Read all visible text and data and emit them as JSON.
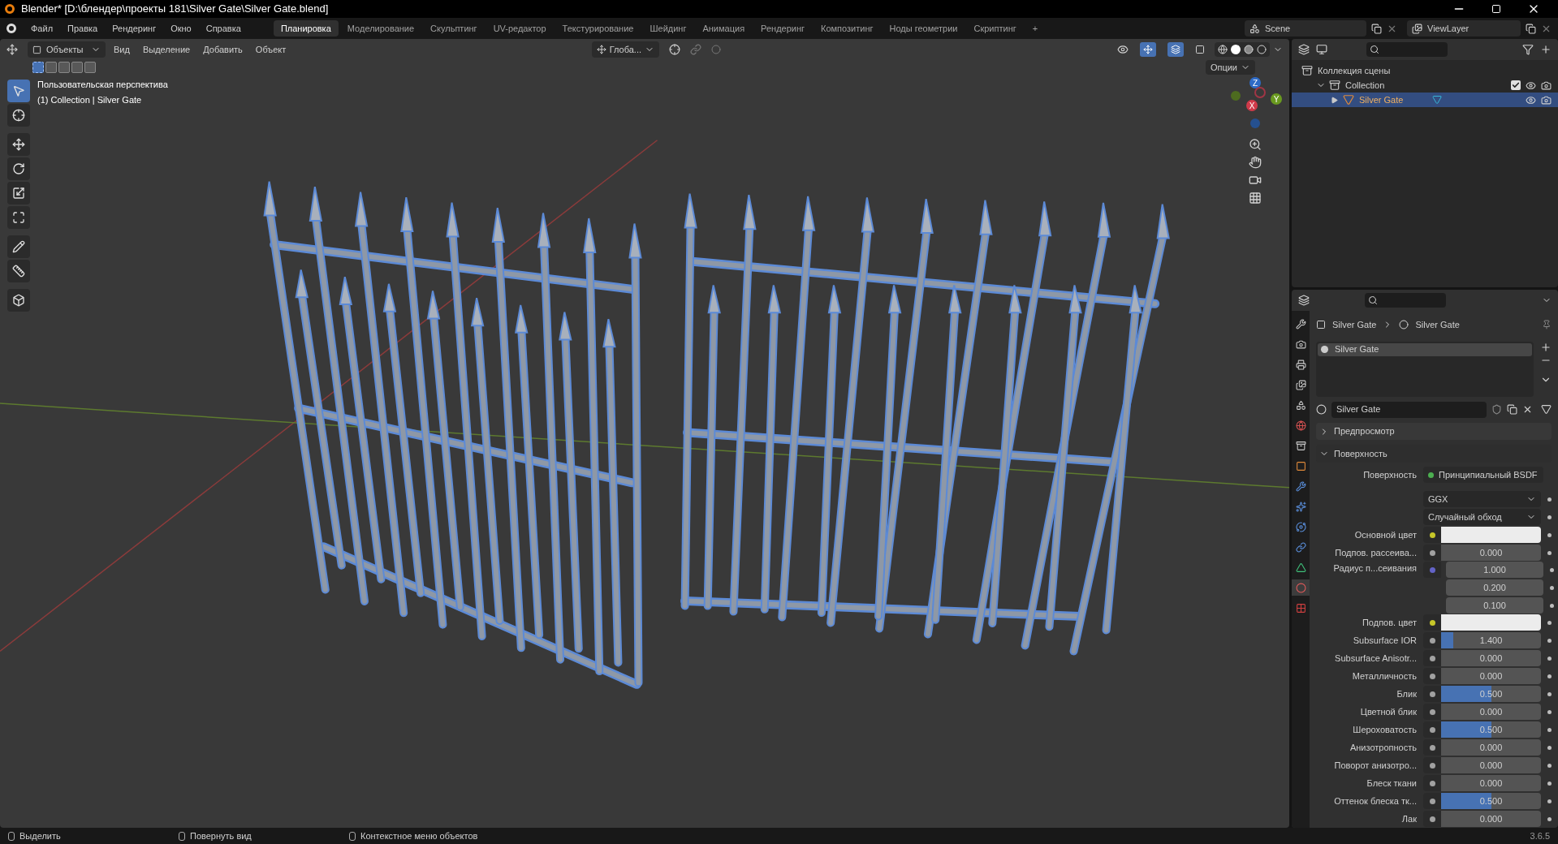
{
  "window": {
    "title": "Blender* [D:\\блендер\\проекты 181\\Silver Gate\\Silver Gate.blend]"
  },
  "menu": [
    "Файл",
    "Правка",
    "Рендеринг",
    "Окно",
    "Справка"
  ],
  "workspaces": [
    {
      "label": "Планировка",
      "selected": true
    },
    {
      "label": "Моделирование",
      "selected": false
    },
    {
      "label": "Скульптинг",
      "selected": false
    },
    {
      "label": "UV-редактор",
      "selected": false
    },
    {
      "label": "Текстурирование",
      "selected": false
    },
    {
      "label": "Шейдинг",
      "selected": false
    },
    {
      "label": "Анимация",
      "selected": false
    },
    {
      "label": "Рендеринг",
      "selected": false
    },
    {
      "label": "Композитинг",
      "selected": false
    },
    {
      "label": "Ноды геометрии",
      "selected": false
    },
    {
      "label": "Скриптинг",
      "selected": false
    },
    {
      "label": "+",
      "selected": false
    }
  ],
  "scene": {
    "name": "Scene",
    "view_layer": "ViewLayer"
  },
  "viewport": {
    "mode": "Объекты",
    "menus": [
      "Вид",
      "Выделение",
      "Добавить",
      "Объект"
    ],
    "orientation": "Глоба...",
    "options": "Опции",
    "perspective": "Пользовательская перспектива",
    "object_info": "(1) Collection | Silver Gate",
    "gizmo_axes": [
      "Z",
      "Y",
      "X"
    ],
    "select_modes": [
      {
        "selected": true
      },
      {
        "selected": false
      },
      {
        "selected": false
      },
      {
        "selected": false
      },
      {
        "selected": false
      }
    ],
    "tools": [
      {
        "kind": "select",
        "selected": true
      },
      {
        "kind": "cursor",
        "selected": false
      },
      {
        "kind": "move",
        "selected": false
      },
      {
        "kind": "rotate",
        "selected": false
      },
      {
        "kind": "scale",
        "selected": false
      },
      {
        "kind": "transform",
        "selected": false
      },
      {
        "kind": "annotate",
        "selected": false
      },
      {
        "kind": "measure",
        "selected": false
      },
      {
        "kind": "add_cube",
        "selected": false
      }
    ]
  },
  "outliner": {
    "items": [
      {
        "label": "Коллекция сцены",
        "kind": "scene_collection",
        "children": [
          {
            "label": "Collection",
            "kind": "collection",
            "expanded": true,
            "checked": true,
            "selected": false,
            "children": [
              {
                "label": "Silver Gate",
                "kind": "object",
                "expanded": false,
                "selected": true
              }
            ]
          }
        ]
      }
    ]
  },
  "properties": {
    "tabs": [
      {
        "kind": "tool",
        "selected": false
      },
      {
        "kind": "render",
        "selected": false
      },
      {
        "kind": "output",
        "selected": false
      },
      {
        "kind": "view_layer",
        "selected": false
      },
      {
        "kind": "scene",
        "selected": false
      },
      {
        "kind": "world",
        "selected": false
      },
      {
        "kind": "collection",
        "selected": false
      },
      {
        "kind": "object",
        "selected": false
      },
      {
        "kind": "modifiers",
        "selected": false
      },
      {
        "kind": "particles",
        "selected": false
      },
      {
        "kind": "physics",
        "selected": false
      },
      {
        "kind": "constraints",
        "selected": false
      },
      {
        "kind": "data",
        "selected": false
      },
      {
        "kind": "material",
        "selected": true
      },
      {
        "kind": "texture",
        "selected": false
      }
    ],
    "breadcrumb": [
      "Silver Gate",
      "Silver Gate"
    ],
    "slots": [
      {
        "label": "Silver Gate",
        "selected": true
      }
    ],
    "material": "Silver Gate",
    "panels": [
      {
        "label": "Предпросмотр",
        "expanded": false
      },
      {
        "label": "Поверхность",
        "expanded": true
      }
    ],
    "rows": [
      {
        "kind": "shader",
        "label": "Поверхность",
        "value": "Принципиальный BSDF",
        "color": "#4caf50"
      },
      {
        "kind": "dropdown",
        "value": "GGX"
      },
      {
        "kind": "dropdown",
        "value": "Случайный обход"
      },
      {
        "kind": "color",
        "label": "Основной цвет",
        "color": "#c7c729"
      },
      {
        "kind": "value",
        "label": "Подпов. рассеива...",
        "value": "0.000",
        "level": 0,
        "color": "#a1a1a1"
      },
      {
        "kind": "vector",
        "label": "Радиус п...сеивания",
        "values": [
          "1.000",
          "0.200",
          "0.100"
        ],
        "color": "#6363c7"
      },
      {
        "kind": "color",
        "label": "Подпов. цвет",
        "color": "#c7c729"
      },
      {
        "kind": "value",
        "label": "Subsurface IOR",
        "value": "1.400",
        "level": 0.12,
        "color": "#a1a1a1"
      },
      {
        "kind": "value",
        "label": "Subsurface Anisotr...",
        "value": "0.000",
        "level": 0,
        "color": "#a1a1a1"
      },
      {
        "kind": "value",
        "label": "Металличность",
        "value": "0.000",
        "level": 0,
        "color": "#a1a1a1"
      },
      {
        "kind": "value",
        "label": "Блик",
        "value": "0.500",
        "level": 0.5,
        "color": "#a1a1a1"
      },
      {
        "kind": "value",
        "label": "Цветной блик",
        "value": "0.000",
        "level": 0,
        "color": "#a1a1a1"
      },
      {
        "kind": "value",
        "label": "Шероховатость",
        "value": "0.500",
        "level": 0.5,
        "color": "#a1a1a1"
      },
      {
        "kind": "value",
        "label": "Анизотропность",
        "value": "0.000",
        "level": 0,
        "color": "#a1a1a1"
      },
      {
        "kind": "value",
        "label": "Поворот анизотро...",
        "value": "0.000",
        "level": 0,
        "color": "#a1a1a1"
      },
      {
        "kind": "value",
        "label": "Блеск ткани",
        "value": "0.000",
        "level": 0,
        "color": "#a1a1a1"
      },
      {
        "kind": "value",
        "label": "Оттенок блеска тк...",
        "value": "0.500",
        "level": 0.5,
        "color": "#a1a1a1"
      },
      {
        "kind": "value",
        "label": "Лак",
        "value": "0.000",
        "level": 0,
        "color": "#a1a1a1"
      }
    ]
  },
  "status_bar": {
    "hints": [
      "Выделить",
      "Повернуть вид",
      "Контекстное меню объектов"
    ],
    "version": "3.6.5"
  }
}
